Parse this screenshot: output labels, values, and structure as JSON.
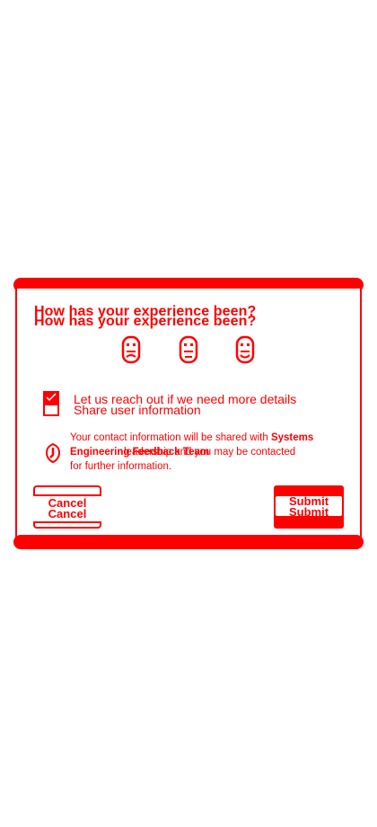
{
  "dialog": {
    "title": "How has your experience been?",
    "faces": [
      "sad-face-icon",
      "neutral-face-icon",
      "happy-face-icon"
    ],
    "options": [
      {
        "label": "Let us reach out if we need more details",
        "checked": true
      },
      {
        "label": "Share user information",
        "checked": false
      }
    ],
    "info": {
      "line1_prefix": "Your contact information will be shared with ",
      "line1_bold": "Systems",
      "line2_overlap_a": "Engineering Feedback Team",
      "line2_overlap_b": "leadership and you may be contacted",
      "line3": "for further information."
    },
    "cancel_label": "Cancel",
    "submit_label": "Submit",
    "accent_color": "#ff0000"
  }
}
